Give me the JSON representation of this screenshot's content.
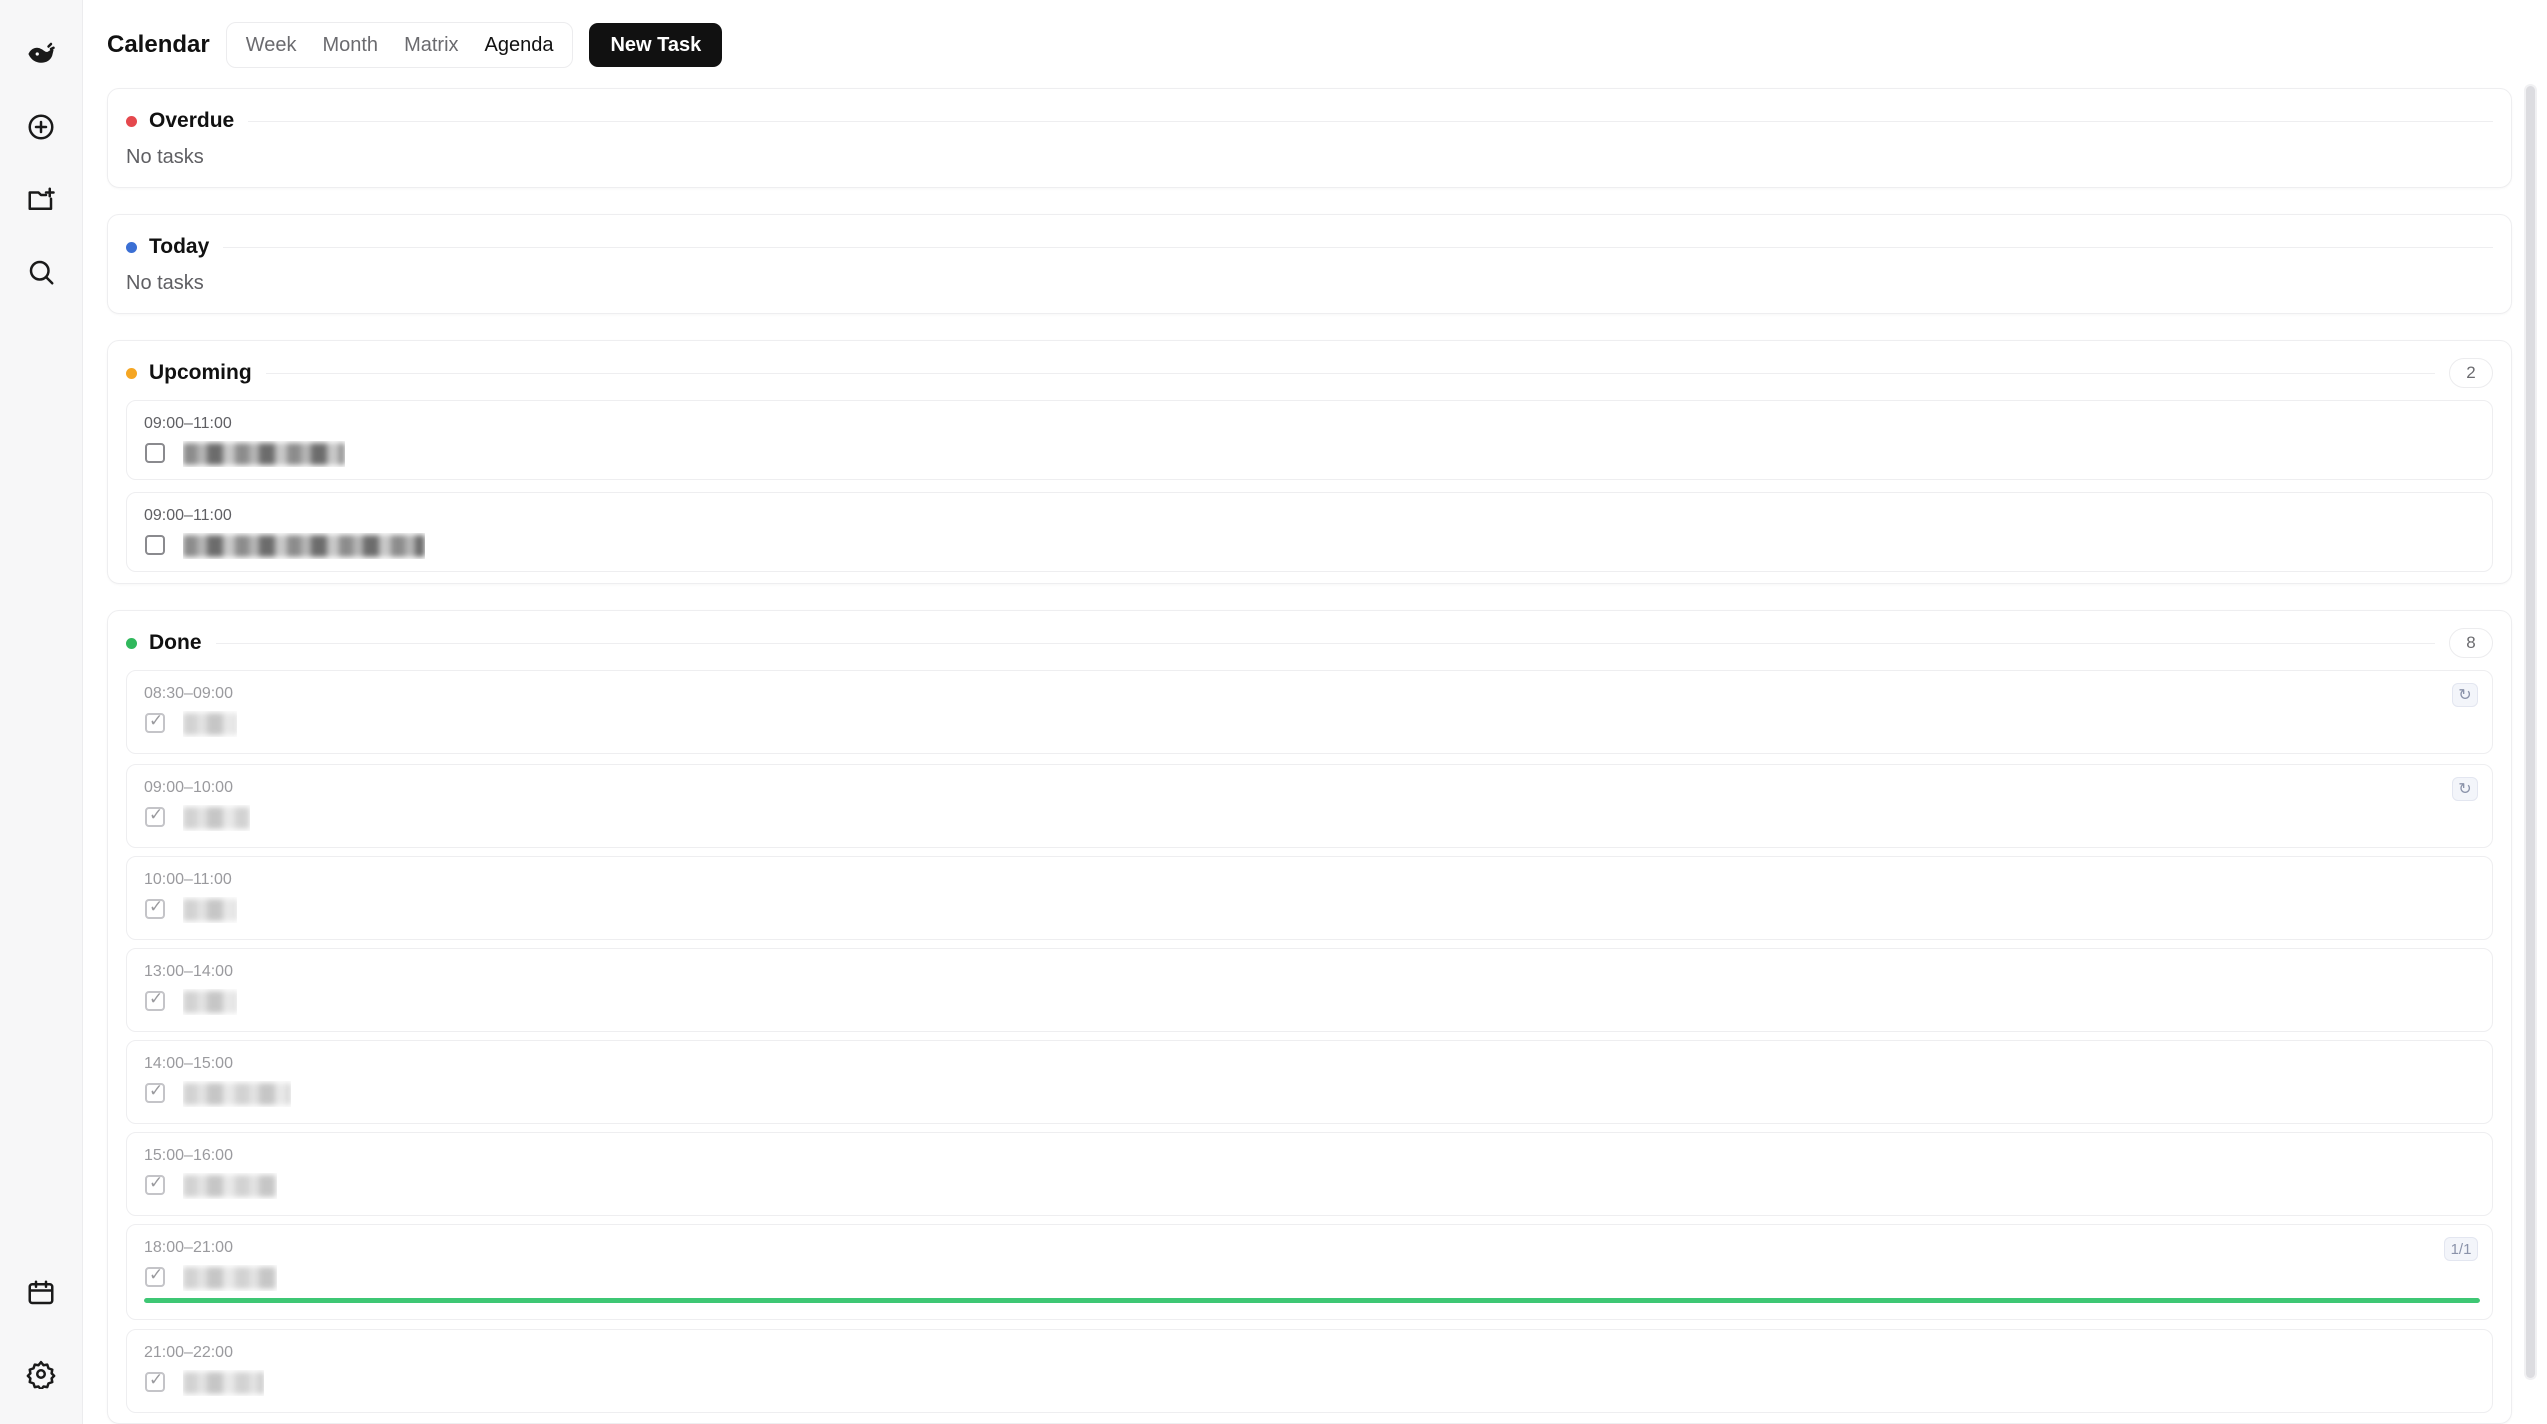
{
  "sidebar": {
    "icons": [
      "logo-icon",
      "add-task-icon",
      "new-folder-icon",
      "search-icon",
      "calendar-icon",
      "settings-icon"
    ]
  },
  "header": {
    "title": "Calendar",
    "tabs": [
      {
        "label": "Week",
        "active": false
      },
      {
        "label": "Month",
        "active": false
      },
      {
        "label": "Matrix",
        "active": false
      },
      {
        "label": "Agenda",
        "active": true
      }
    ],
    "new_task_label": "New Task"
  },
  "sections": {
    "overdue": {
      "title": "Overdue",
      "color": "#e5484d",
      "empty_text": "No tasks"
    },
    "today": {
      "title": "Today",
      "color": "#3b6fd4",
      "empty_text": "No tasks"
    },
    "upcoming": {
      "title": "Upcoming",
      "color": "#f5a623",
      "count": "2",
      "tasks": [
        {
          "time": "09:00–11:00",
          "name": "████████████",
          "done": false
        },
        {
          "time": "09:00–11:00",
          "name": "██████████████████",
          "done": false
        }
      ]
    },
    "done": {
      "title": "Done",
      "color": "#30b85c",
      "count": "8",
      "repeat_glyph": "↻",
      "tasks": [
        {
          "time": "08:30–09:00",
          "name": "████",
          "done": true,
          "repeat": true
        },
        {
          "time": "09:00–10:00",
          "name": "█████",
          "done": true,
          "repeat": true
        },
        {
          "time": "10:00–11:00",
          "name": "████",
          "done": true
        },
        {
          "time": "13:00–14:00",
          "name": "████",
          "done": true
        },
        {
          "time": "14:00–15:00",
          "name": "████████",
          "done": true
        },
        {
          "time": "15:00–16:00",
          "name": "███████",
          "done": true
        },
        {
          "time": "18:00–21:00",
          "name": "███████",
          "done": true,
          "progress_label": "1/1",
          "progress": 1.0
        },
        {
          "time": "21:00–22:00",
          "name": "██████",
          "done": true
        }
      ]
    }
  }
}
